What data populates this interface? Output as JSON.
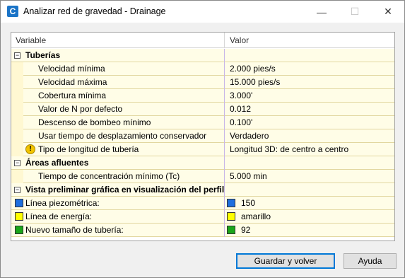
{
  "window": {
    "title": "Analizar red de gravedad - Drainage",
    "app_icon_letter": "C",
    "minimize_glyph": "—",
    "maximize_glyph": "☐",
    "close_glyph": "✕"
  },
  "grid": {
    "headers": {
      "variable": "Variable",
      "value": "Valor"
    },
    "sections": {
      "tuberias": {
        "label": "Tuberías",
        "rows": [
          {
            "label": "Velocidad mínima",
            "value": "2.000 pies/s"
          },
          {
            "label": "Velocidad máxima",
            "value": "15.000 pies/s"
          },
          {
            "label": "Cobertura mínima",
            "value": "3.000'"
          },
          {
            "label": "Valor de N por defecto",
            "value": "0.012"
          },
          {
            "label": "Descenso de bombeo mínimo",
            "value": "0.100'"
          },
          {
            "label": "Usar tiempo de desplazamiento conservador",
            "value": "Verdadero"
          },
          {
            "label": "Tipo de longitud de tubería",
            "value": "Longitud 3D: de centro a centro"
          }
        ]
      },
      "areas": {
        "label": "Áreas afluentes",
        "rows": [
          {
            "label": "Tiempo de concentración mínimo (Tc)",
            "value": "5.000 min"
          }
        ]
      },
      "vista": {
        "label": "Vista preliminar gráfica en visualización del perfil",
        "rows": [
          {
            "label": "Línea piezométrica:",
            "value": "150",
            "color": "#1e6fe0"
          },
          {
            "label": "Línea de energía:",
            "value": "amarillo",
            "color": "#ffff00"
          },
          {
            "label": "Nuevo tamaño de tubería:",
            "value": "92",
            "color": "#1aa61a"
          }
        ]
      }
    },
    "expander_glyph": "−",
    "warning_glyph": "!"
  },
  "buttons": {
    "save_label": "Guardar y volver",
    "help_label": "Ayuda"
  }
}
